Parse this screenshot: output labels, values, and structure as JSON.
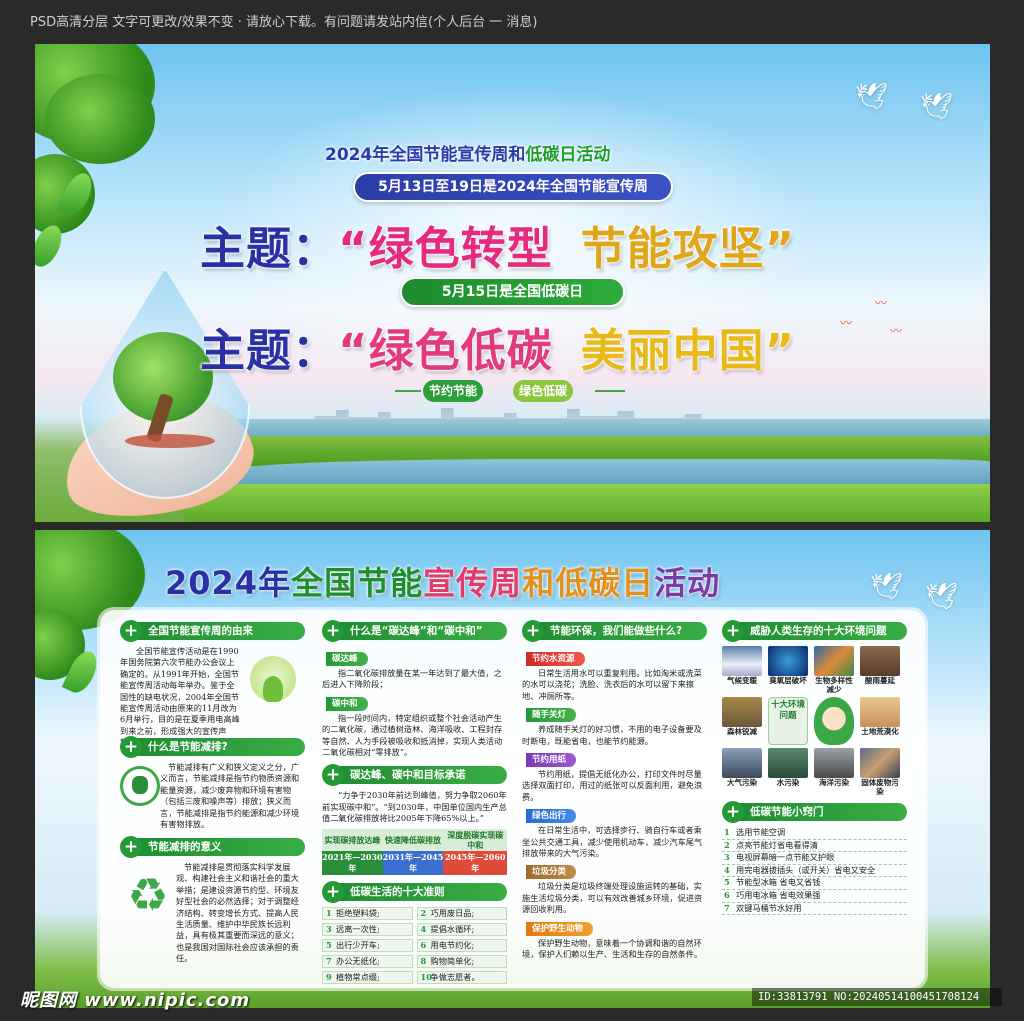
{
  "topbar": {
    "notice": "PSD高清分层 文字可更改/效果不变 · 请放心下载。有问题请发站内信(个人后台 一 消息)"
  },
  "panel1": {
    "title_part1": "2024年全国节能宣传周和",
    "title_part2": "低碳日活动",
    "week_pill": "5月13日至19日是2024年全国节能宣传周",
    "theme_label": "主题：",
    "theme1_a": "“绿色转型",
    "theme1_b": "节能攻坚”",
    "day_pill": "5月15日是全国低碳日",
    "theme2_a": "“绿色低碳",
    "theme2_b": "美丽中国”",
    "tag1": "节约节能",
    "tag2": "绿色低碳"
  },
  "panel2": {
    "title": {
      "c1": "2024年",
      "c2": "全国节能",
      "c3": "宣传周",
      "c4": "和低碳日",
      "c5": "活动"
    },
    "col1": {
      "sec1_head": "全国节能宣传周的由来",
      "sec1_text": "全国节能宣传活动是在1990年国务院第六次节能办公会议上确定的。从1991年开始，全国节能宣传周活动每年举办。鉴于全国性的缺电状况，2004年全国节能宣传周活动由原来的11月改为6月举行，目的是在夏季用电高峰到来之前，形成强大的宣传声势，唤起人们的节能意识。",
      "sec2_head": "什么是节能减排?",
      "sec2_text": "节能减排有广义和狭义定义之分，广义而言，节能减排是指节约物质资源和能量资源，减少废弃物和环境有害物（包括三废和噪声等）排放；狭义而言，节能减排是指节约能源和减少环境有害物排放。",
      "sec3_head": "节能减排的意义",
      "sec3_text": "节能减排是贯彻落实科学发展观、构建社会主义和谐社会的重大举措；是建设资源节约型、环境友好型社会的必然选择；对于调整经济结构、转变增长方式、提高人民生活质量、维护中华民族长远利益，具有极其重要而深远的意义；也是我国对国际社会应该承担的责任。"
    },
    "col2": {
      "sec1_head": "什么是“碳达峰”和“碳中和”",
      "tag1": "碳达峰",
      "text1": "指二氧化碳排放量在某一年达到了最大值，之后进入下降阶段；",
      "tag2": "碳中和",
      "text2": "指一段时间内，特定组织或整个社会活动产生的二氧化碳，通过植树造林、海洋吸收、工程封存等自然、人为手段被吸收和抵消掉，实现人类活动二氧化碳相对“零排放”。",
      "sec2_head": "碳达峰、碳中和目标承诺",
      "text3": "“力争于2030年前达到峰值，努力争取2060年前实现碳中和”。“到2030年，中国单位国内生产总值二氧化碳排放将比2005年下降65%以上。”",
      "table_heads": [
        "实现碳排放达峰",
        "快速降低碳排放",
        "深度脱碳实现碳中和"
      ],
      "table_years": [
        "2021年—2030年",
        "2031年—2045年",
        "2045年—2060年"
      ],
      "sec3_head": "低碳生活的十大准则",
      "rules": [
        "拒绝塑料袋;",
        "巧用废日品;",
        "远离一次性;",
        "提倡水循环;",
        "出行少开车;",
        "用电节约化;",
        "办公无纸化;",
        "购物简单化;",
        "植物常点缀;",
        "争做志愿者。"
      ]
    },
    "col3": {
      "sec1_head": "节能环保，我们能做些什么?",
      "tag1": "节约水资源",
      "text1": "日常生活用水可以重复利用。比如淘米或洗菜的水可以浇花；洗脸、洗衣后的水可以留下来擦地、冲厕所等。",
      "tag2": "随手关灯",
      "text2": "养成随手关灯的好习惯，不用的电子设备要及时断电，既能省电，也能节约能源。",
      "tag3": "节约用纸",
      "text3": "节约用纸，提倡无纸化办公，打印文件时尽量选择双面打印，用过的纸张可以反面利用，避免浪费。",
      "tag4": "绿色出行",
      "text4": "在日常生活中，可选择步行、骑自行车或者乘坐公共交通工具，减少使用机动车，减少汽车尾气排放带来的大气污染。",
      "tag5": "垃圾分类",
      "text5": "垃圾分类是垃圾终端处理设施运转的基础，实施生活垃圾分类，可以有效改善城乡环境，促进资源回收利用。",
      "tag6": "保护野生动物",
      "text6": "保护野生动物，意味着一个协调和谐的自然环境，保护人们赖以生产、生活和生存的自然条件。"
    },
    "col4": {
      "sec1_head": "威胁人类生存的十大环境问题",
      "env_row1": [
        "气候变暖",
        "臭氧层破坏",
        "生物多样性减少",
        "酸雨蔓延"
      ],
      "env_row2_left": "森林锐减",
      "env_center": "十大环境问题",
      "env_row2_right": "土地荒漠化",
      "env_row3": [
        "大气污染",
        "水污染",
        "海洋污染",
        "固体废物污染"
      ],
      "sec2_head": "低碳节能小窍门",
      "tips": [
        "选用节能空调",
        "点亮节能灯省电看得清",
        "电视屏幕暗一点节能又护眼",
        "用完电器拔插头（或开关）省电又安全",
        "节能型冰箱 省电又省钱",
        "巧用电冰箱 省电效果强",
        "双键马桶节水好用"
      ]
    }
  },
  "watermark": {
    "left": "昵图网 www.nipic.com",
    "right": "ID:33813791 NO:20240514100451708124"
  }
}
